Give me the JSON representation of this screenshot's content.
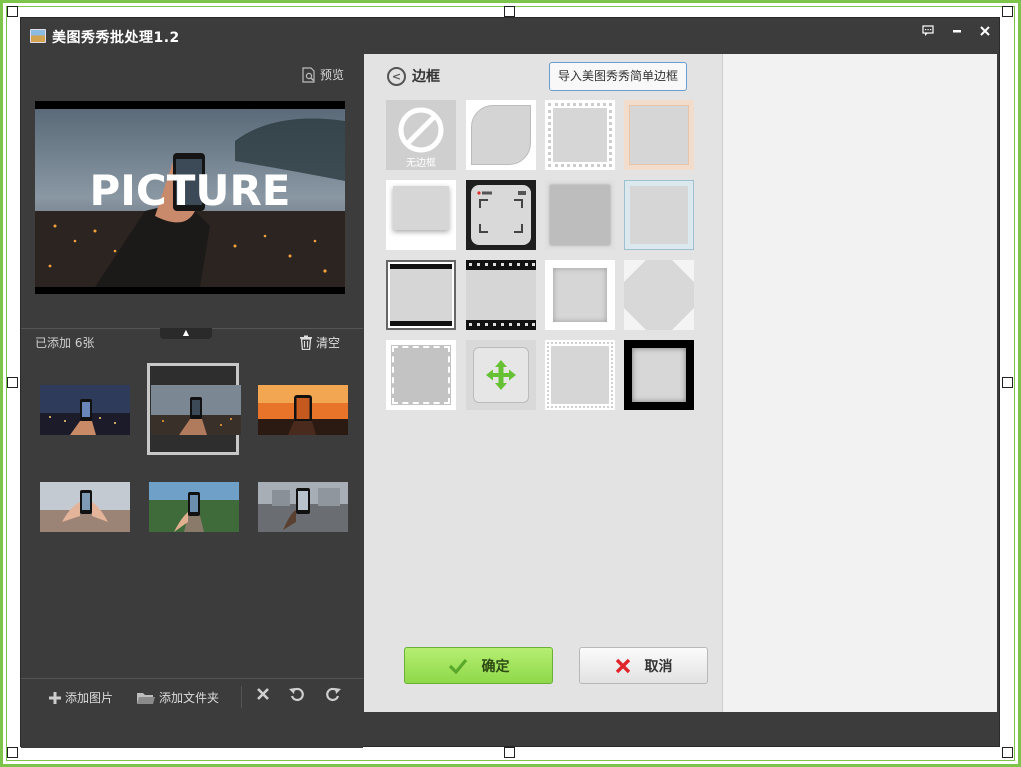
{
  "window": {
    "title": "美图秀秀批处理1.2",
    "icons": [
      "app-icon",
      "chat-icon",
      "minimize-icon",
      "close-icon"
    ]
  },
  "left": {
    "preview_label": "预览",
    "preview_text": "PICTURE",
    "added_count": "已添加 6张",
    "clear_label": "清空",
    "thumbnails": [
      "city-night",
      "city-fog-selected",
      "sunset",
      "hands-phone",
      "railway-forest",
      "street-phone"
    ],
    "toolbar": {
      "add_image": "添加图片",
      "add_folder": "添加文件夹"
    }
  },
  "right": {
    "section_title": "边框",
    "import_button": "导入美图秀秀简单边框",
    "no_frame_label": "无边框",
    "frames": [
      "no-frame",
      "rounded-leaf",
      "stamp-edge",
      "peach-border",
      "white-shadow",
      "camera-viewfinder",
      "gray-brush",
      "blue-watercolor",
      "black-bars",
      "film-strip",
      "soft-shadow",
      "corner-triangles",
      "gray-stamp",
      "move-frame",
      "lace-edge",
      "thick-black"
    ],
    "ok_label": "确定",
    "cancel_label": "取消"
  },
  "colors": {
    "selection": "#7cc44a",
    "window_bg": "#3c3c3c",
    "panel_bg": "#e3e3e3",
    "ok_green": "#8fd84a",
    "cancel_red": "#e0262b"
  }
}
